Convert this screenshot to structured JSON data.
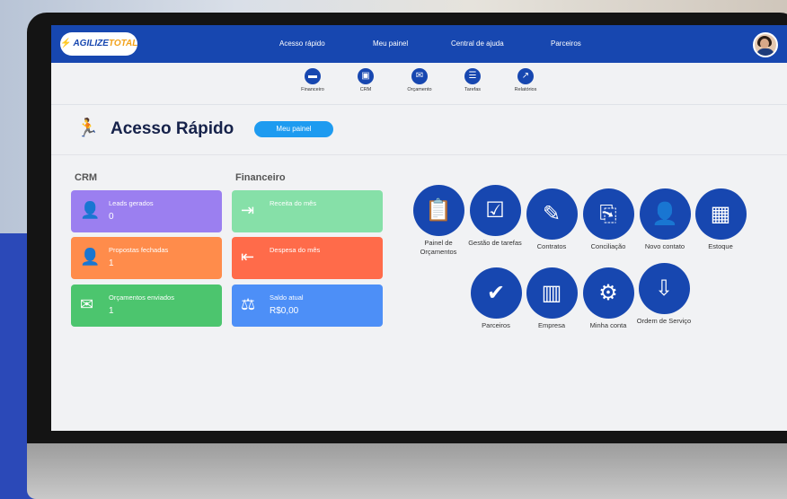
{
  "app": {
    "logo_prefix": "AGILIZE",
    "logo_suffix": "TOTAL"
  },
  "topnav": [
    {
      "label": "Acesso rápido"
    },
    {
      "label": "Meu painel"
    },
    {
      "label": "Central de ajuda"
    },
    {
      "label": "Parceiros"
    }
  ],
  "iconbar": [
    {
      "label": "Financeiro",
      "icon": "wallet-icon"
    },
    {
      "label": "CRM",
      "icon": "contact-card-icon"
    },
    {
      "label": "Orçamento",
      "icon": "envelope-icon"
    },
    {
      "label": "Tarefas",
      "icon": "task-list-icon"
    },
    {
      "label": "Relatórios",
      "icon": "line-chart-icon"
    }
  ],
  "header": {
    "title": "Acesso Rápido",
    "button": "Meu painel"
  },
  "crm": {
    "title": "CRM",
    "cards": [
      {
        "label": "Leads gerados",
        "value": "0",
        "icon": "add-user-icon",
        "color": "#9b7ff0"
      },
      {
        "label": "Propostas fechadas",
        "value": "1",
        "icon": "user-check-icon",
        "color": "#ff8c4b"
      },
      {
        "label": "Orçamentos enviados",
        "value": "1",
        "icon": "envelope-icon",
        "color": "#4cc56e"
      }
    ]
  },
  "financeiro": {
    "title": "Financeiro",
    "cards": [
      {
        "label": "Receita do mês",
        "value": "",
        "icon": "sign-in-icon",
        "color": "#86e0a8"
      },
      {
        "label": "Despesa do mês",
        "value": "",
        "icon": "sign-out-icon",
        "color": "#ff6b4a"
      },
      {
        "label": "Saldo atual",
        "value": "R$0,00",
        "icon": "balance-scale-icon",
        "color": "#4d8ff7"
      }
    ]
  },
  "quick_access": [
    {
      "label": "Painel de Orçamentos",
      "icon": "clipboard-search-icon"
    },
    {
      "label": "Gestão de tarefas",
      "icon": "checklist-icon"
    },
    {
      "label": "Contratos",
      "icon": "document-edit-icon"
    },
    {
      "label": "Conciliação",
      "icon": "file-import-icon"
    },
    {
      "label": "Novo contato",
      "icon": "add-user-icon"
    },
    {
      "label": "Estoque",
      "icon": "boxes-icon"
    },
    {
      "label": "Parceiros",
      "icon": "shield-check-icon"
    },
    {
      "label": "Empresa",
      "icon": "building-gear-icon"
    },
    {
      "label": "Minha conta",
      "icon": "user-gear-icon"
    },
    {
      "label": "Ordem de Serviço",
      "icon": "service-order-icon"
    }
  ],
  "colors": {
    "primary": "#1747b0",
    "accent": "#1e9bf0",
    "logo_accent": "#f2a21b"
  }
}
